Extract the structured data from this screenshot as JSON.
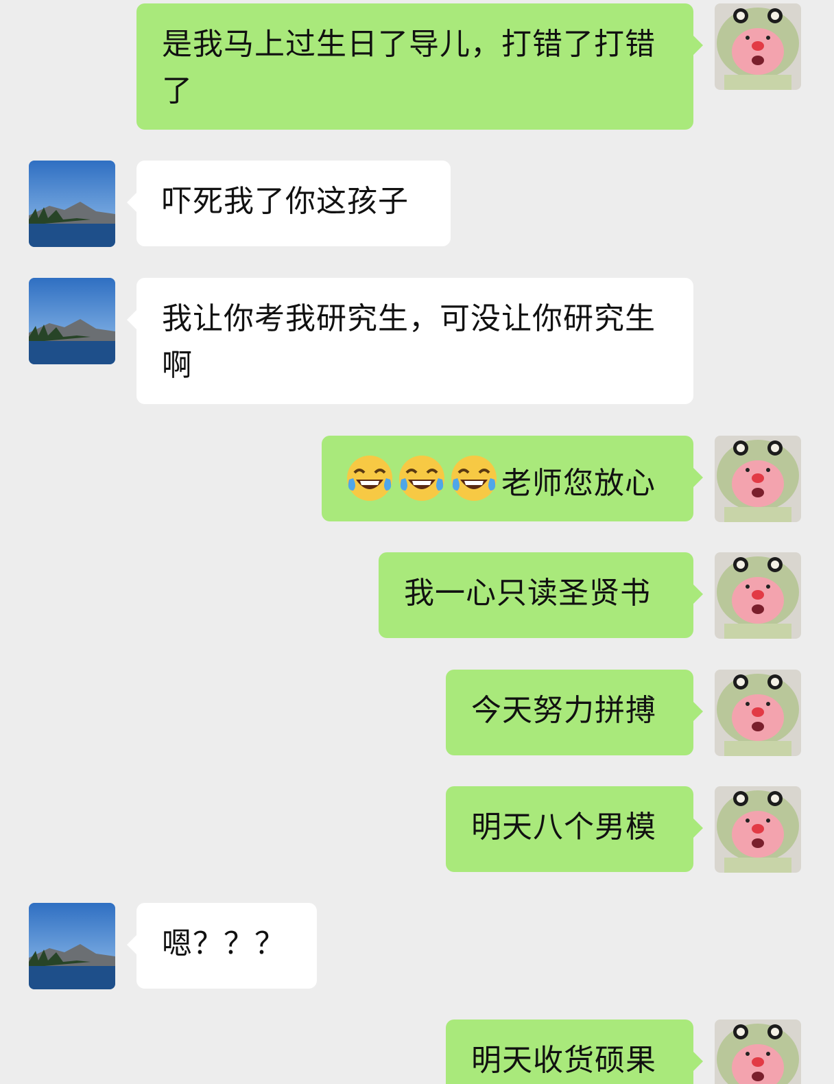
{
  "chat": {
    "messages": [
      {
        "side": "right",
        "text": "是我马上过生日了导儿，打错了打错了"
      },
      {
        "side": "left",
        "text": "吓死我了你这孩子"
      },
      {
        "side": "left",
        "text": "我让你考我研究生，可没让你研究生啊"
      },
      {
        "side": "right",
        "emoji": [
          "face-with-tears-of-joy",
          "face-with-tears-of-joy",
          "face-with-tears-of-joy"
        ],
        "text": "老师您放心"
      },
      {
        "side": "right",
        "text": "我一心只读圣贤书"
      },
      {
        "side": "right",
        "text": "今天努力拼搏"
      },
      {
        "side": "right",
        "text": "明天八个男模"
      },
      {
        "side": "left",
        "text": "嗯？？？"
      },
      {
        "side": "right",
        "text": "明天收货硕果"
      }
    ]
  },
  "avatars": {
    "self": "plush-doll-green-hood-avatar",
    "other": "lake-mountain-landscape-avatar"
  },
  "colors": {
    "background": "#ededed",
    "self_bubble": "#a9e97b",
    "other_bubble": "#ffffff"
  }
}
